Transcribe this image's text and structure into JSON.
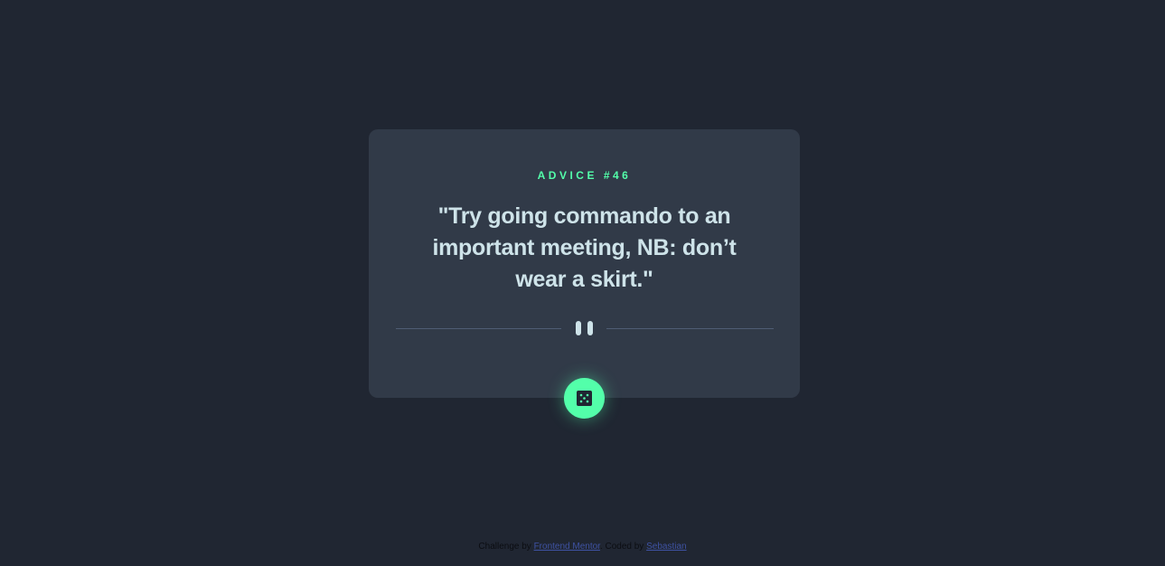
{
  "advice": {
    "label": "ADVICE #46",
    "quote": "\"Try going commando to an important meeting, NB: don’t wear a skirt.\""
  },
  "icons": {
    "divider": "pause-icon",
    "button": "dice-icon"
  },
  "footer": {
    "prefix": "Challenge by",
    "challenge_link": "Frontend Mentor",
    "middle": ". Coded by",
    "author_link": "Sebastian"
  },
  "colors": {
    "background": "#202632",
    "card": "#313a48",
    "accent": "#53ffaa",
    "quote_text": "#cee3e9",
    "link": "#3e52a3"
  }
}
